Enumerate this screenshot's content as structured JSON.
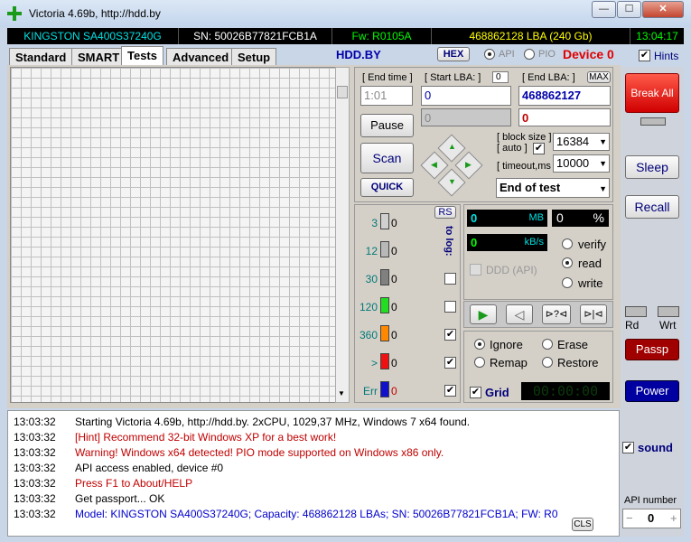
{
  "window": {
    "title": "Victoria 4.69b, http://hdd.by",
    "minimize": "—",
    "maximize": "☐",
    "close": "✕"
  },
  "info": {
    "model": "KINGSTON SA400S37240G",
    "serial": "SN: 50026B77821FCB1A",
    "firmware": "Fw: R0105A",
    "lba": "468862128 LBA (240 Gb)",
    "time": "13:04:17",
    "colors": {
      "model": "#00e0e0",
      "serial": "#ffffff",
      "firmware": "#00ff00",
      "lba": "#ffff00",
      "time": "#00ff00"
    }
  },
  "tabs": [
    "Standard",
    "SMART",
    "Tests",
    "Advanced",
    "Setup"
  ],
  "header": {
    "site": "HDD.BY",
    "hex": "HEX",
    "api": "API",
    "pio": "PIO",
    "device": "Device 0",
    "hints": "Hints"
  },
  "scan": {
    "end_time_label": "[ End time ]",
    "end_time_value": "1:01",
    "start_lba_label": "[ Start LBA: ]",
    "start_lba_small": "0",
    "start_lba": "0",
    "end_lba_label": "[ End LBA: ]",
    "max_label": "MAX",
    "end_lba": "468862127",
    "cur_lba": "0",
    "cur_red": "0",
    "pause": "Pause",
    "scan": "Scan",
    "quick": "QUICK",
    "block_size_label": "[ block size ]",
    "auto_label": "[ auto ]",
    "block_size": "16384",
    "timeout_label": "[ timeout,ms ]",
    "timeout": "10000",
    "end_action": "End of test"
  },
  "stats": {
    "rs": "RS",
    "tolog": "to log:",
    "rows": [
      {
        "label": "3",
        "count": "0",
        "color": "#d0d0d0"
      },
      {
        "label": "12",
        "count": "0",
        "color": "#b8b8b8"
      },
      {
        "label": "30",
        "count": "0",
        "color": "#808080"
      },
      {
        "label": "120",
        "count": "0",
        "color": "#22dd22"
      },
      {
        "label": "360",
        "count": "0",
        "color": "#ff8800"
      },
      {
        "label": ">",
        "count": "0",
        "color": "#ee1111"
      },
      {
        "label": "Err",
        "count": "0",
        "color": "#1111cc"
      }
    ],
    "log_checked": [
      false,
      false,
      false,
      false,
      true,
      true,
      true
    ]
  },
  "progress": {
    "mb": "0",
    "mb_unit": "MB",
    "percent": "0",
    "percent_unit": "%",
    "speed": "0",
    "speed_unit": "kB/s",
    "ddd": "DDD (API)",
    "verify": "verify",
    "read": "read",
    "write": "write"
  },
  "actions": {
    "ignore": "Ignore",
    "erase": "Erase",
    "remap": "Remap",
    "restore": "Restore",
    "grid": "Grid",
    "timer": "00:00:00"
  },
  "right": {
    "break": "Break All",
    "sleep": "Sleep",
    "recall": "Recall",
    "rd": "Rd",
    "wrt": "Wrt",
    "passp": "Passp",
    "power": "Power",
    "sound": "sound",
    "api_number_label": "API number",
    "api_number": "0",
    "minus": "−",
    "plus": "+"
  },
  "log": {
    "cls": "CLS",
    "lines": [
      {
        "time": "13:03:32",
        "text": "Starting Victoria 4.69b, http://hdd.by. 2xCPU, 1029,37 MHz, Windows 7 x64 found.",
        "color": "#000000"
      },
      {
        "time": "13:03:32",
        "text": "[Hint] Recommend 32-bit Windows XP for a best work!",
        "color": "#c00000"
      },
      {
        "time": "13:03:32",
        "text": "Warning! Windows x64 detected! PIO mode supported on Windows x86 only.",
        "color": "#c00000"
      },
      {
        "time": "13:03:32",
        "text": "API access enabled, device #0",
        "color": "#000000"
      },
      {
        "time": "13:03:32",
        "text": "Press F1 to About/HELP",
        "color": "#c00000"
      },
      {
        "time": "13:03:32",
        "text": "Get passport... OK",
        "color": "#000000"
      },
      {
        "time": "13:03:32",
        "text": "Model: KINGSTON SA400S37240G; Capacity: 468862128 LBAs; SN: 50026B77821FCB1A; FW: R0",
        "color": "#0000cc"
      }
    ]
  }
}
